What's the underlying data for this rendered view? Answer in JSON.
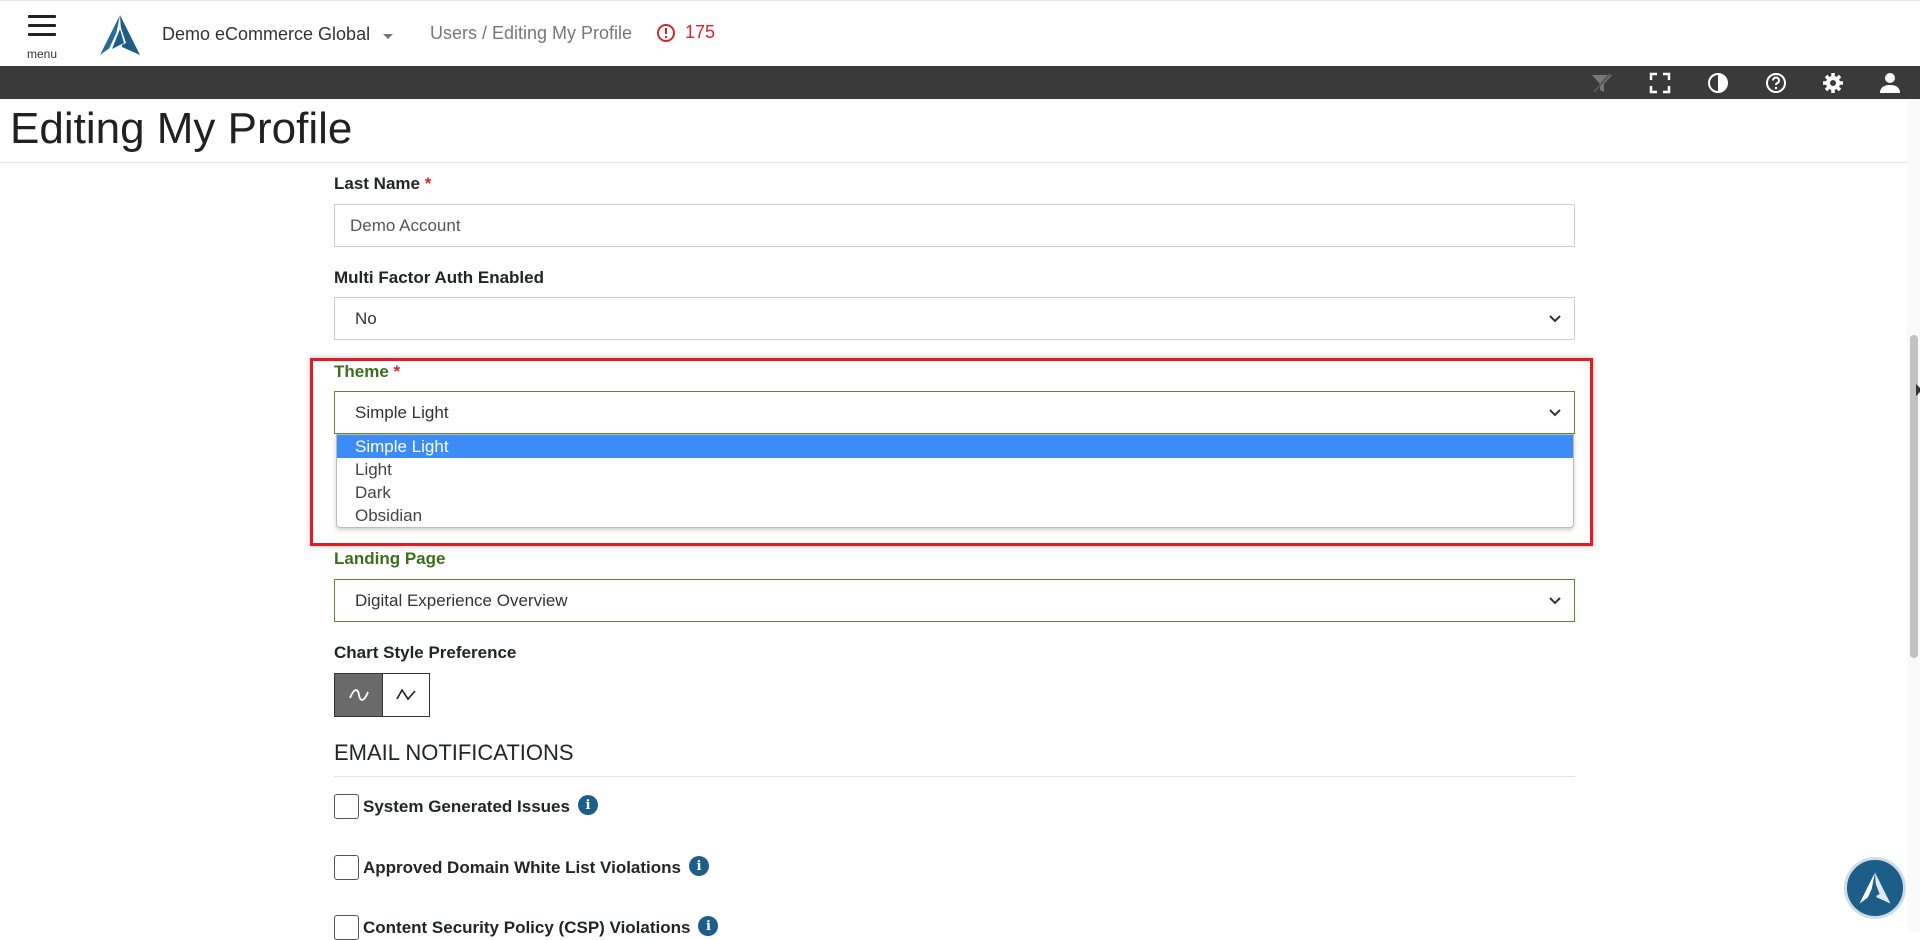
{
  "header": {
    "menu_label": "menu",
    "org_name": "Demo eCommerce Global",
    "breadcrumb": "Users / Editing My Profile",
    "alert_count": "175"
  },
  "toolbar_icons": [
    "filter-icon",
    "fullscreen-icon",
    "contrast-icon",
    "help-icon",
    "settings-icon",
    "user-icon"
  ],
  "page": {
    "title": "Editing My Profile"
  },
  "form": {
    "last_name": {
      "label": "Last Name",
      "required": "*",
      "value": "Demo Account"
    },
    "mfa": {
      "label": "Multi Factor Auth Enabled",
      "value": "No"
    },
    "theme": {
      "label": "Theme",
      "required": "*",
      "value": "Simple Light",
      "options": [
        "Simple Light",
        "Light",
        "Dark",
        "Obsidian"
      ],
      "selected_index": 0
    },
    "landing_page": {
      "label": "Landing Page",
      "value": "Digital Experience Overview"
    },
    "chart_style": {
      "label": "Chart Style Preference",
      "active": "smooth"
    }
  },
  "email_notifications": {
    "heading": "EMAIL NOTIFICATIONS",
    "items": [
      {
        "label": "System Generated Issues",
        "checked": false
      },
      {
        "label": "Approved Domain White List Violations",
        "checked": false
      },
      {
        "label": "Content Security Policy (CSP) Violations",
        "checked": false
      }
    ]
  },
  "colors": {
    "accent_blue": "#1d5d8a",
    "alert_red": "#d9232d",
    "valid_green": "#3c6e1e",
    "option_highlight": "#3b8cf5",
    "annotation_red": "#e31b23"
  }
}
